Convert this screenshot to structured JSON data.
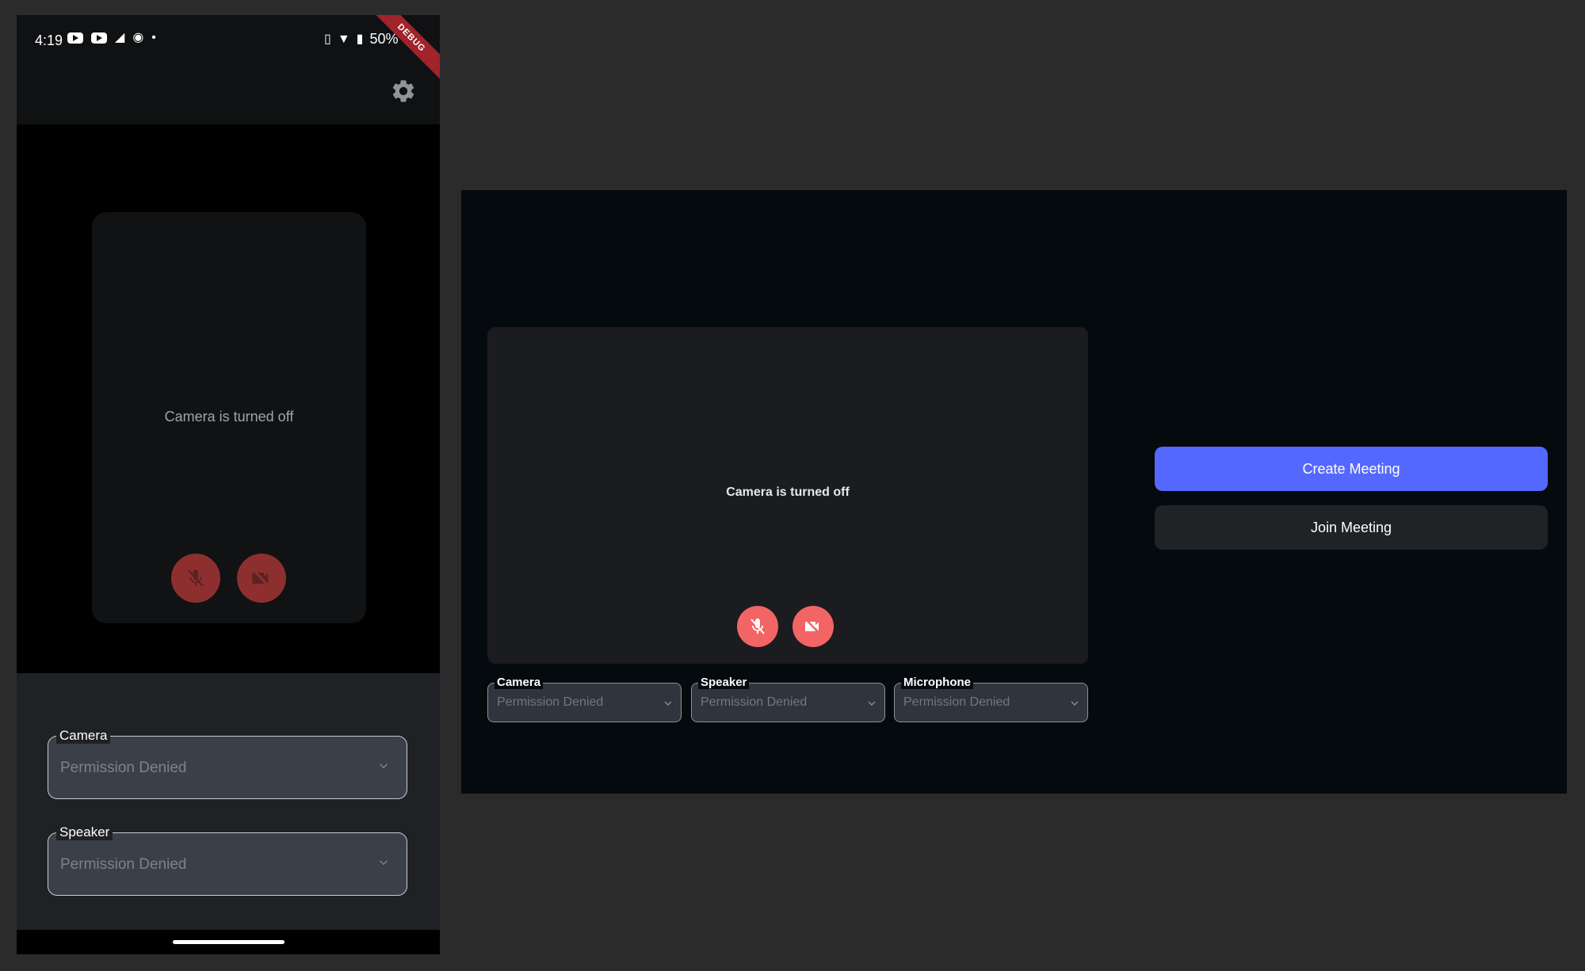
{
  "mobile": {
    "status_bar": {
      "time": "4:19",
      "battery": "50%"
    },
    "debug_banner": "DEBUG",
    "preview": {
      "camera_off_text": "Camera is turned off"
    },
    "fields": [
      {
        "label": "Camera",
        "value": "Permission Denied"
      },
      {
        "label": "Speaker",
        "value": "Permission Denied"
      }
    ]
  },
  "desktop": {
    "preview": {
      "camera_off_text": "Camera is turned off"
    },
    "fields": [
      {
        "label": "Camera",
        "value": "Permission Denied"
      },
      {
        "label": "Speaker",
        "value": "Permission Denied"
      },
      {
        "label": "Microphone",
        "value": "Permission Denied"
      }
    ],
    "buttons": {
      "create": "Create Meeting",
      "join": "Join Meeting"
    }
  },
  "icons": {
    "settings": "gear-icon",
    "mic_off": "mic-off-icon",
    "video_off": "video-off-icon",
    "dropdown": "chevron-down-icon"
  },
  "colors": {
    "primary_button": "#5568fe",
    "secondary_button": "#1f2326",
    "control_off_mobile": "#8e2f2f",
    "control_off_desktop": "#f36565"
  }
}
